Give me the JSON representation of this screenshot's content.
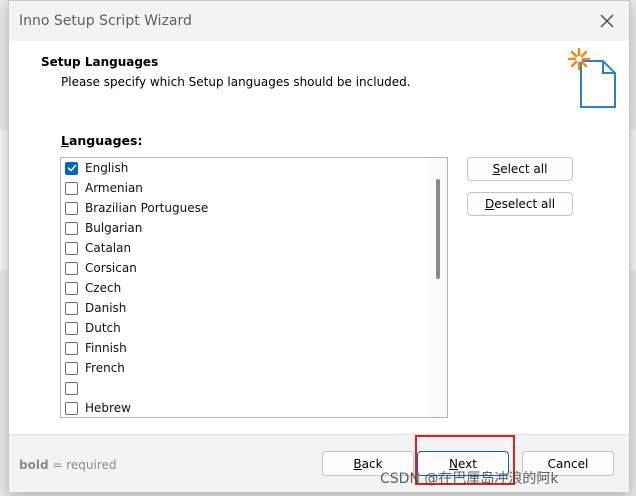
{
  "window": {
    "title": "Inno Setup Script Wizard"
  },
  "header": {
    "title": "Setup Languages",
    "subtitle": "Please specify which Setup languages should be included."
  },
  "languages": {
    "label_accel": "L",
    "label_rest": "anguages:",
    "items": [
      {
        "label": "English",
        "checked": true
      },
      {
        "label": "Armenian",
        "checked": false
      },
      {
        "label": "Brazilian Portuguese",
        "checked": false
      },
      {
        "label": "Bulgarian",
        "checked": false
      },
      {
        "label": "Catalan",
        "checked": false
      },
      {
        "label": "Corsican",
        "checked": false
      },
      {
        "label": "Czech",
        "checked": false
      },
      {
        "label": "Danish",
        "checked": false
      },
      {
        "label": "Dutch",
        "checked": false
      },
      {
        "label": "Finnish",
        "checked": false
      },
      {
        "label": "French",
        "checked": false
      },
      {
        "label": "",
        "checked": false
      },
      {
        "label": "Hebrew",
        "checked": false
      }
    ]
  },
  "buttons": {
    "select_all_accel": "S",
    "select_all_rest": "elect all",
    "deselect_all_accel": "D",
    "deselect_all_rest": "eselect all",
    "back_accel": "B",
    "back_rest": "ack",
    "next_accel": "N",
    "next_rest": "ext",
    "cancel": "Cancel"
  },
  "footer": {
    "note_bold": "bold",
    "note_rest": " = required"
  },
  "watermark": "CSDN @在巴厘岛冲浪的阿k",
  "colors": {
    "accent": "#0067c0",
    "highlight": "#e02020",
    "icon_star": "#f08a1e",
    "icon_page": "#2f7fc1"
  },
  "icons": {
    "close": "close-icon",
    "wizard": "wizard-page-star-icon",
    "check": "checkmark-icon"
  }
}
